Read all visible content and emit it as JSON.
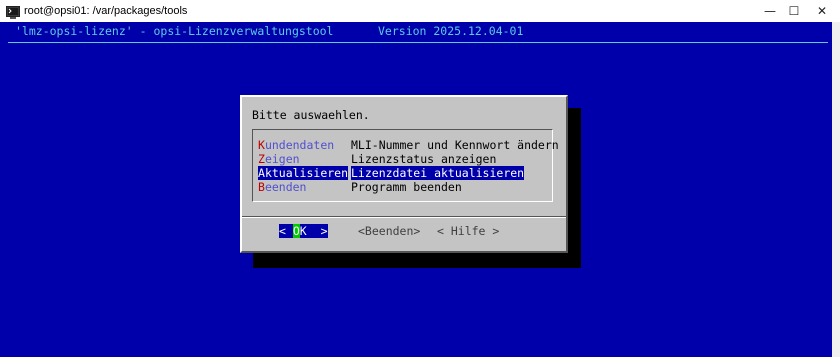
{
  "window": {
    "title": "root@opsi01: /var/packages/tools",
    "minimize_glyph": "—",
    "maximize_glyph": "☐",
    "close_glyph": "✕"
  },
  "header": {
    "app": "'lmz-opsi-lizenz' - opsi-Lizenzverwaltungstool",
    "version": "Version 2025.12.04-01"
  },
  "dialog": {
    "prompt": "Bitte auswaehlen.",
    "items": [
      {
        "hotkey": "K",
        "rest": "undendaten",
        "desc": "MLI-Nummer und Kennwort ändern",
        "selected": false
      },
      {
        "hotkey": "Z",
        "rest": "eigen",
        "desc": "Lizenzstatus anzeigen",
        "selected": false
      },
      {
        "hotkey": "A",
        "rest": "ktualisieren",
        "desc": "Lizenzdatei aktualisieren",
        "selected": true
      },
      {
        "hotkey": "B",
        "rest": "eenden",
        "desc": "Programm beenden",
        "selected": false
      }
    ],
    "buttons": {
      "ok_left": "< ",
      "ok_hot": "O",
      "ok_rest": "K  >",
      "beenden": "<Beenden>",
      "hilfe": "< Hilfe >"
    }
  },
  "colors": {
    "background": "#0000aa",
    "header_text": "#5ecbe6",
    "dialog": "#c4c4c4",
    "hotkey": "#c00000",
    "item_text": "#5050d0",
    "ok_hotkey": "#00cc00"
  }
}
